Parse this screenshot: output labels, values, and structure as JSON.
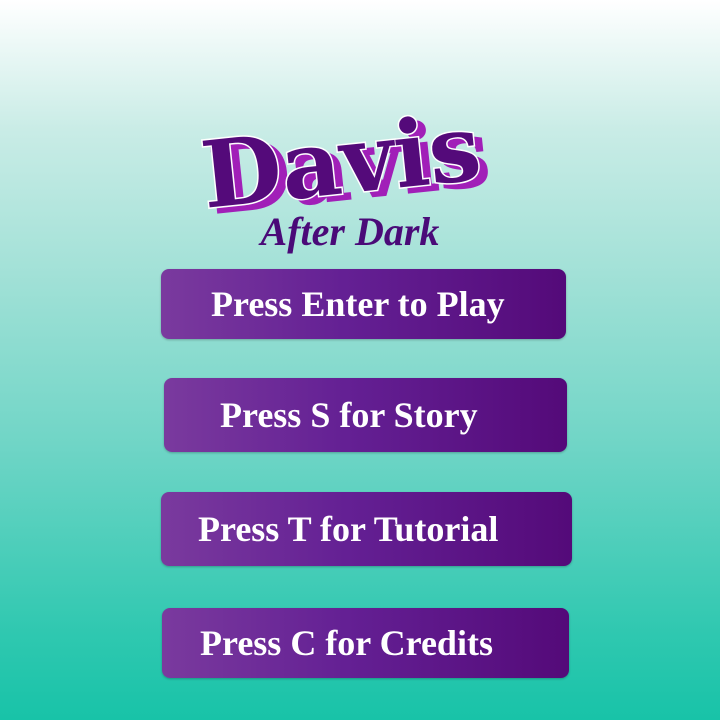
{
  "game": {
    "logo_text": "Davis",
    "subtitle": "After Dark",
    "logo_colors": {
      "fill": "#540a7a",
      "outline": "#ffffff",
      "shadow": "#a11fb8"
    }
  },
  "menu": {
    "play_label": "Press Enter to Play",
    "story_label": "Press S for Story",
    "tutorial_label": "Press T for Tutorial",
    "credits_label": "Press C for Credits"
  },
  "colors": {
    "button_start": "#7a3a9e",
    "button_end": "#540a79",
    "background_top": "#ffffff",
    "background_bottom": "#18c3a8",
    "subtitle": "#4a0a78"
  }
}
